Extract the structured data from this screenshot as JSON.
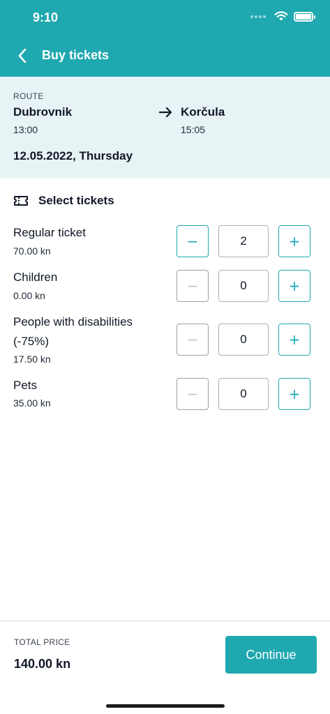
{
  "status_bar": {
    "time": "9:10"
  },
  "nav": {
    "title": "Buy tickets",
    "back_icon": "chevron-left-icon"
  },
  "route": {
    "label": "ROUTE",
    "from": {
      "city": "Dubrovnik",
      "time": "13:00"
    },
    "to": {
      "city": "Korčula",
      "time": "15:05"
    },
    "date": "12.05.2022, Thursday"
  },
  "tickets_section": {
    "title": "Select tickets",
    "icon": "ticket-icon",
    "items": [
      {
        "name": "Regular ticket",
        "price": "70.00 kn",
        "quantity": "2",
        "minus": "−",
        "plus": "+"
      },
      {
        "name": "Children",
        "price": "0.00 kn",
        "quantity": "0",
        "minus": "−",
        "plus": "+"
      },
      {
        "name": "People with disabilities",
        "name_line2": "(-75%)",
        "price": "17.50 kn",
        "quantity": "0",
        "minus": "−",
        "plus": "+"
      },
      {
        "name": "Pets",
        "price": "35.00 kn",
        "quantity": "0",
        "minus": "−",
        "plus": "+"
      }
    ]
  },
  "footer": {
    "total_label": "TOTAL PRICE",
    "total_value": "140.00 kn",
    "continue_label": "Continue"
  },
  "colors": {
    "accent": "#1fa8b0",
    "route_bg": "#e8f3f5"
  }
}
